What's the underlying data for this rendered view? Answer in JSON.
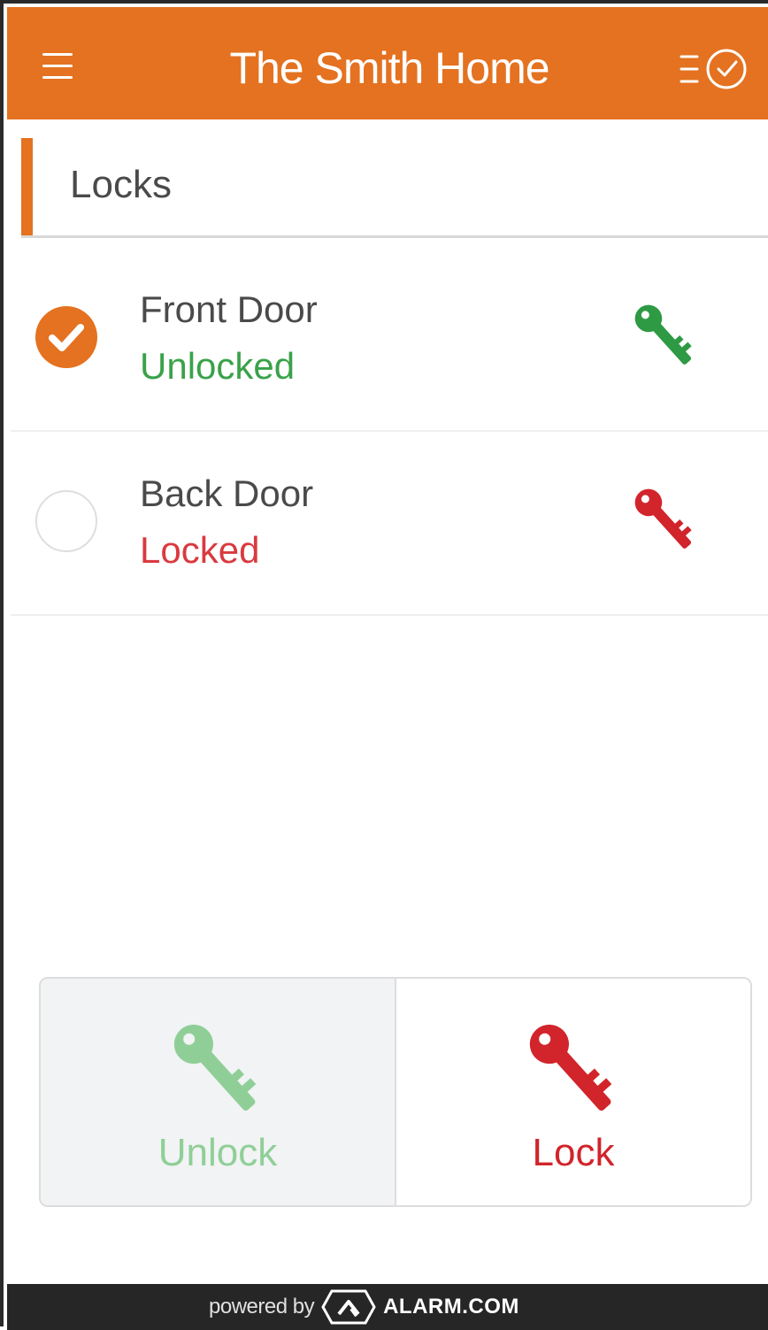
{
  "header": {
    "title": "The Smith Home",
    "menu_icon": "hamburger-menu-icon",
    "history_icon": "list-clock-icon"
  },
  "section": {
    "title": "Locks"
  },
  "locks": [
    {
      "name": "Front Door",
      "status": "Unlocked",
      "status_color": "#3aa24a",
      "selected": true,
      "key_color": "#2e9a44"
    },
    {
      "name": "Back Door",
      "status": "Locked",
      "status_color": "#d93a3f",
      "selected": false,
      "key_color": "#d2242b"
    }
  ],
  "actions": {
    "unlock_label": "Unlock",
    "lock_label": "Lock",
    "unlock_color": "#8fcf97",
    "lock_color": "#d2242b"
  },
  "footer": {
    "powered_by": "powered by",
    "brand": "ALARM.COM"
  },
  "colors": {
    "accent": "#e47220",
    "footer_bg": "#262626"
  }
}
